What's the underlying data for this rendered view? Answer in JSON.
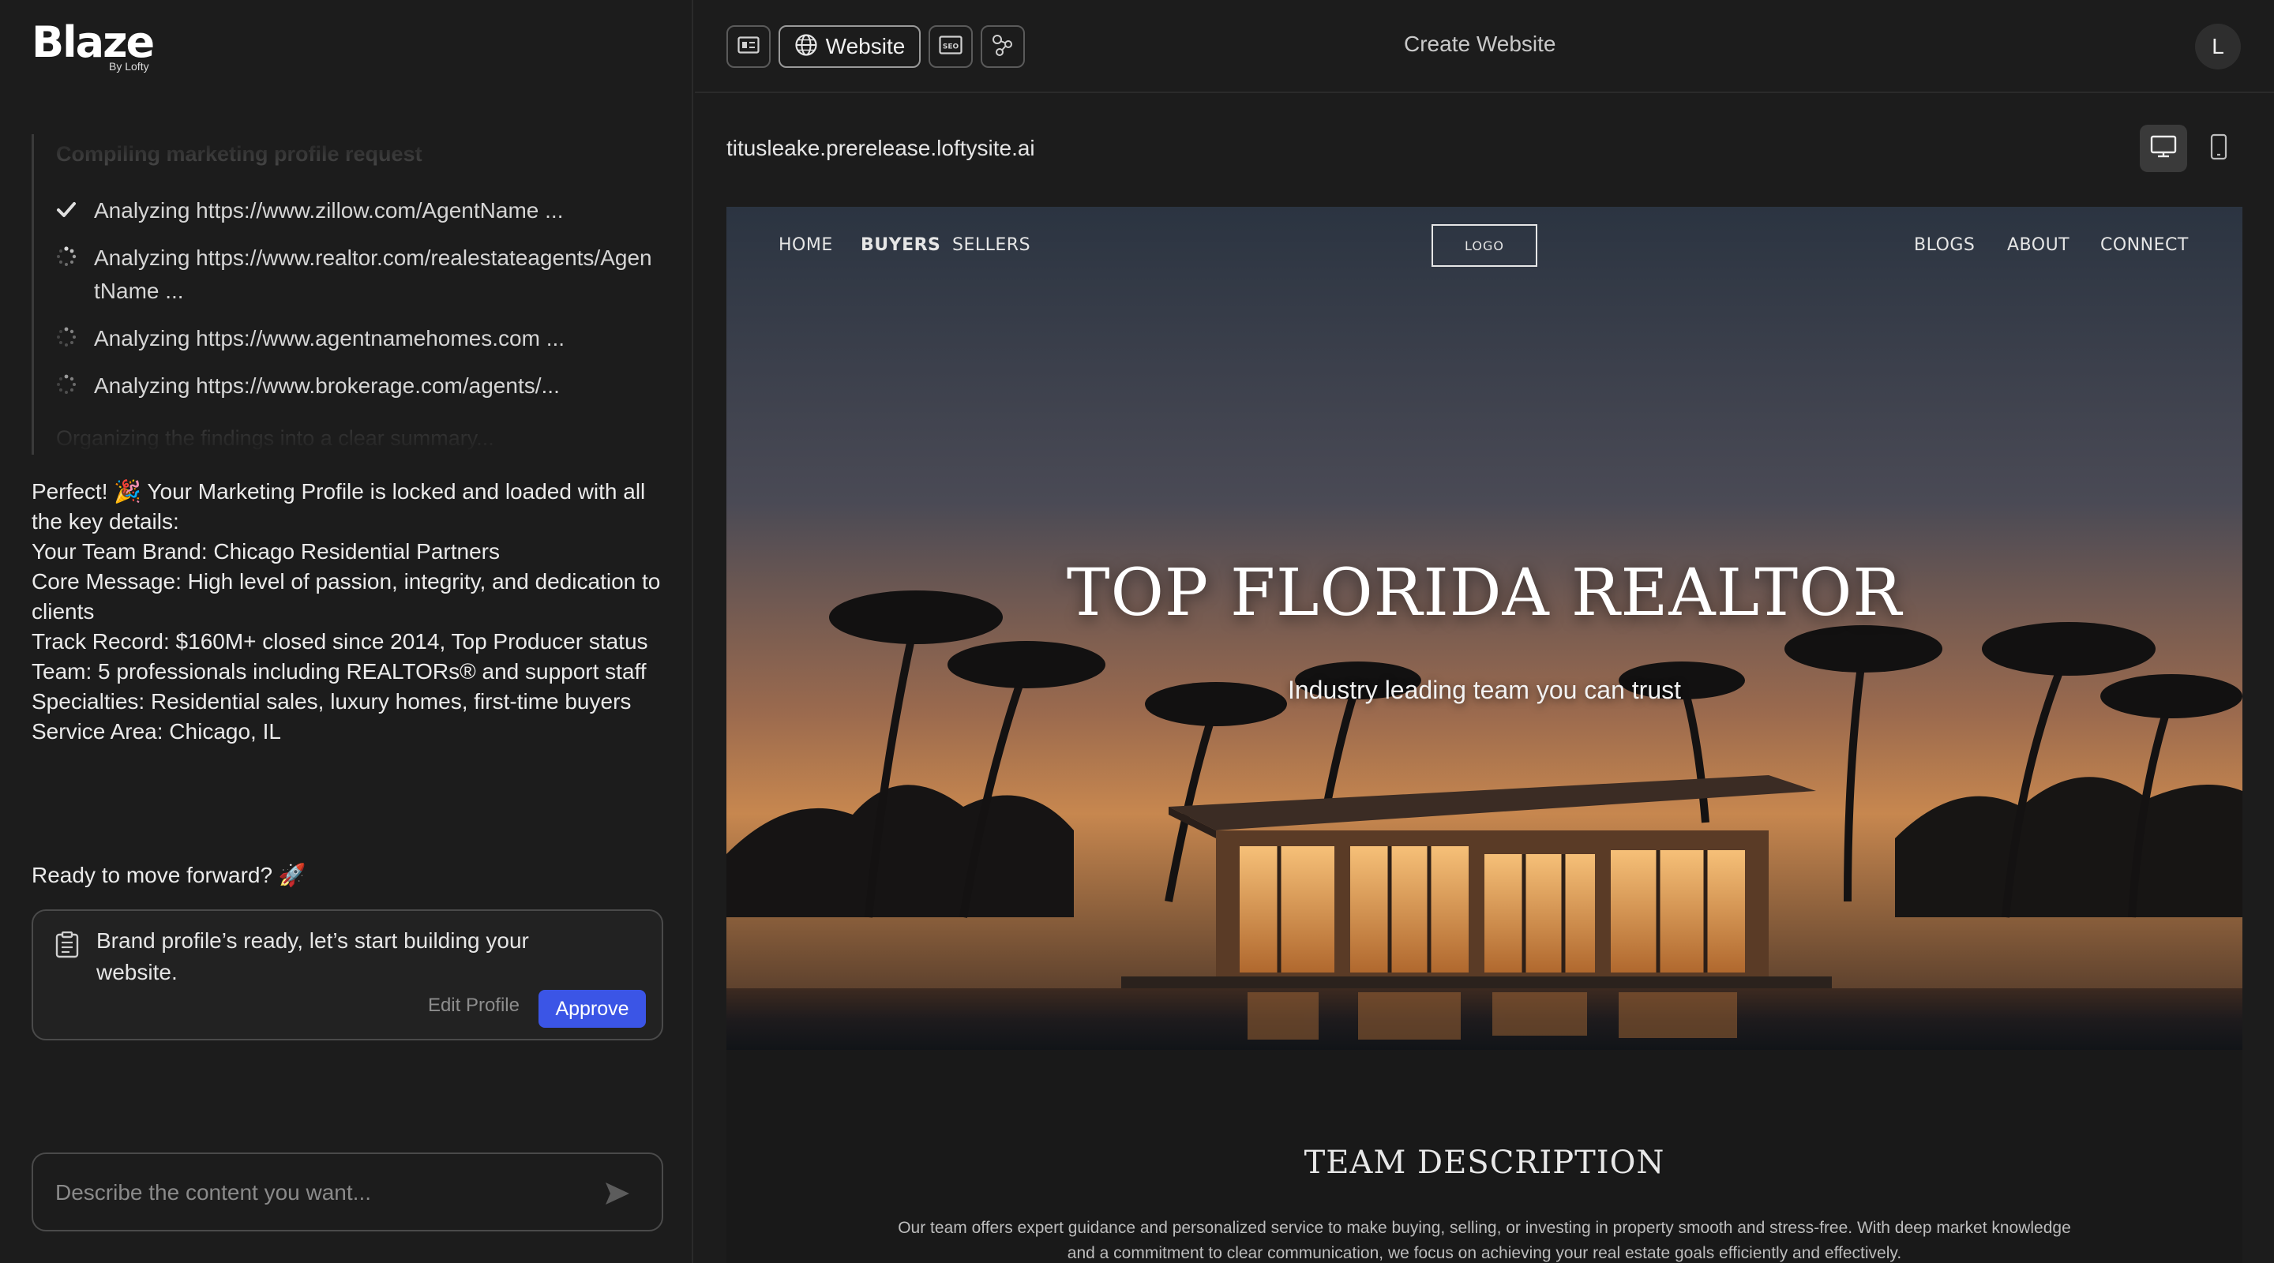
{
  "app": {
    "logo": "Blaze",
    "logo_sub": "By Lofty"
  },
  "progress": {
    "heading": "Compiling marketing profile request",
    "items": [
      {
        "text": "Analyzing https://www.zillow.com/AgentName ...",
        "status": "done"
      },
      {
        "text": "Analyzing https://www.realtor.com/realestateagents/Agen tName ...",
        "status": "loading"
      },
      {
        "text": "Analyzing https://www.agentnamehomes.com ...",
        "status": "loading"
      },
      {
        "text": "Analyzing https://www.brokerage.com/agents/...",
        "status": "loading"
      }
    ],
    "tail": "Organizing the findings into a clear summary..."
  },
  "message": {
    "lines": [
      "Perfect! 🎉 Your Marketing Profile is locked and loaded with all the key details:",
      "Your Team Brand: Chicago Residential Partners",
      "Core Message: High level of passion, integrity, and dedication to clients",
      "Track Record: $160M+ closed since 2014, Top Producer status",
      "Team: 5 professionals including REALTORs® and support staff",
      "Specialties: Residential sales, luxury homes, first-time buyers",
      "Service Area: Chicago, IL"
    ],
    "ready": "Ready to move forward? 🚀"
  },
  "brand_card": {
    "text": "Brand profile’s ready, let’s start building your website.",
    "edit_label": "Edit Profile",
    "approve_label": "Approve"
  },
  "chat": {
    "placeholder": "Describe the content you want..."
  },
  "topbar": {
    "website_label": "Website",
    "title": "Create Website",
    "avatar_initial": "L"
  },
  "preview": {
    "url": "titusleake.prerelease.loftysite.ai",
    "nav_left": [
      "HOME",
      "BUYERS",
      "SELLERS"
    ],
    "logo_label": "LOGO",
    "nav_right": [
      "BLOGS",
      "ABOUT",
      "CONNECT"
    ],
    "hero_title": "TOP FLORIDA REALTOR",
    "hero_subtitle": "Industry leading team you can trust",
    "section_title": "TEAM DESCRIPTION",
    "section_text": "Our team offers expert guidance and personalized service to make buying, selling, or investing in property smooth and stress-free. With deep market knowledge and a commitment to clear communication, we focus on achieving your real estate goals efficiently and effectively."
  },
  "colors": {
    "background": "#1c1c1c",
    "accent": "#3b55e6",
    "border": "#4a4a4a"
  },
  "icons": {
    "done": "checkmark-icon",
    "loading": "spinner-icon",
    "doc": "document-icon",
    "send": "send-icon",
    "desktop": "desktop-icon",
    "mobile": "mobile-icon"
  }
}
